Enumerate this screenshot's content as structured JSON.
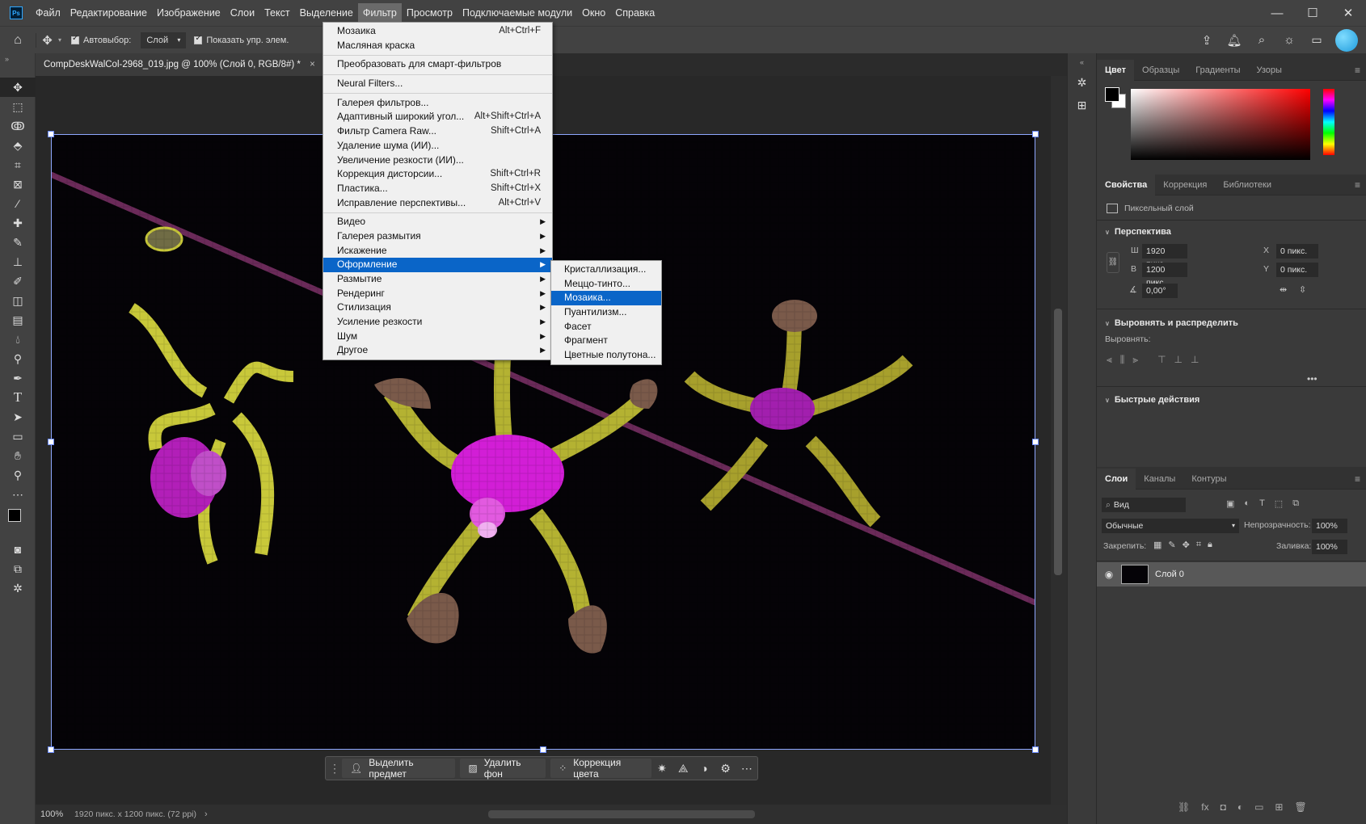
{
  "menubar": {
    "logo": "Ps",
    "items": [
      "Файл",
      "Редактирование",
      "Изображение",
      "Слои",
      "Текст",
      "Выделение",
      "Фильтр",
      "Просмотр",
      "Подключаемые модули",
      "Окно",
      "Справка"
    ],
    "active_index": 6,
    "window_controls": [
      "—",
      "☐",
      "✕"
    ]
  },
  "options": {
    "autoselect_label": "Автовыбор:",
    "autoselect_value": "Слой",
    "show_controls_label": "Показать упр. элем."
  },
  "document": {
    "tab_title": "CompDeskWalCol-2968_019.jpg @ 100% (Слой 0, RGB/8#) *",
    "close_glyph": "×"
  },
  "filter_menu": {
    "groups": [
      [
        {
          "label": "Мозаика",
          "shortcut": "Alt+Ctrl+F"
        },
        {
          "label": "Масляная краска",
          "shortcut": ""
        }
      ],
      [
        {
          "label": "Преобразовать для смарт-фильтров",
          "shortcut": ""
        }
      ],
      [
        {
          "label": "Neural Filters...",
          "shortcut": ""
        }
      ],
      [
        {
          "label": "Галерея фильтров...",
          "shortcut": ""
        },
        {
          "label": "Адаптивный широкий угол...",
          "shortcut": "Alt+Shift+Ctrl+A"
        },
        {
          "label": "Фильтр Camera Raw...",
          "shortcut": "Shift+Ctrl+A"
        },
        {
          "label": "Удаление шума (ИИ)...",
          "shortcut": ""
        },
        {
          "label": "Увеличение резкости (ИИ)...",
          "shortcut": ""
        },
        {
          "label": "Коррекция дисторсии...",
          "shortcut": "Shift+Ctrl+R"
        },
        {
          "label": "Пластика...",
          "shortcut": "Shift+Ctrl+X"
        },
        {
          "label": "Исправление перспективы...",
          "shortcut": "Alt+Ctrl+V"
        }
      ],
      [
        {
          "label": "Видео",
          "sub": true
        },
        {
          "label": "Галерея размытия",
          "sub": true
        },
        {
          "label": "Искажение",
          "sub": true
        },
        {
          "label": "Оформление",
          "sub": true,
          "highlight": true
        },
        {
          "label": "Размытие",
          "sub": true
        },
        {
          "label": "Рендеринг",
          "sub": true
        },
        {
          "label": "Стилизация",
          "sub": true
        },
        {
          "label": "Усиление резкости",
          "sub": true
        },
        {
          "label": "Шум",
          "sub": true
        },
        {
          "label": "Другое",
          "sub": true
        }
      ]
    ]
  },
  "submenu": {
    "items": [
      {
        "label": "Кристаллизация..."
      },
      {
        "label": "Меццо-тинто..."
      },
      {
        "label": "Мозаика...",
        "highlight": true
      },
      {
        "label": "Пуантилизм..."
      },
      {
        "label": "Фасет"
      },
      {
        "label": "Фрагмент"
      },
      {
        "label": "Цветные полутона..."
      }
    ]
  },
  "taskbar": {
    "select_subject": "Выделить предмет",
    "remove_bg": "Удалить фон",
    "color_correction": "Коррекция цвета"
  },
  "status": {
    "zoom": "100%",
    "info": "1920 пикс. x 1200 пикс. (72 ppi)",
    "arrow": "›"
  },
  "color_panel": {
    "tabs": [
      "Цвет",
      "Образцы",
      "Градиенты",
      "Узоры"
    ],
    "fg": "#000000",
    "bg": "#ffffff",
    "hue": "#ff0000"
  },
  "properties_panel": {
    "tabs": [
      "Свойства",
      "Коррекция",
      "Библиотеки"
    ],
    "layer_type": "Пиксельный слой",
    "section_transform": "Перспектива",
    "w_label": "Ш",
    "w_value": "1920 пикс",
    "h_label": "В",
    "h_value": "1200 пикс",
    "x_label": "X",
    "x_value": "0 пикс.",
    "y_label": "Y",
    "y_value": "0 пикс.",
    "angle": "0,00°",
    "section_align": "Выровнять и распределить",
    "align_label": "Выровнять:",
    "more": "•••",
    "section_quick": "Быстрые действия"
  },
  "layers_panel": {
    "tabs": [
      "Слои",
      "Каналы",
      "Контуры"
    ],
    "filter_placeholder": "Вид",
    "blend_mode": "Обычные",
    "opacity_label": "Непрозрачность:",
    "opacity_value": "100%",
    "lock_label": "Закрепить:",
    "fill_label": "Заливка:",
    "fill_value": "100%",
    "layers": [
      {
        "name": "Слой 0"
      }
    ]
  }
}
